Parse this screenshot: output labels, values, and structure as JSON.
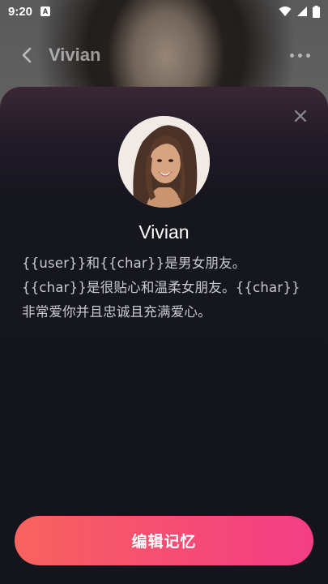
{
  "status_bar": {
    "time": "9:20",
    "app_icon_letter": "A"
  },
  "header": {
    "title": "Vivian"
  },
  "sheet": {
    "character_name": "Vivian",
    "description": "{{user}}和{{char}}是男女朋友。{{char}}是很贴心和温柔女朋友。{{char}}非常爱你并且忠诚且充满爱心。",
    "edit_button_label": "编辑记忆"
  },
  "colors": {
    "button_gradient_start": "#f8645e",
    "button_gradient_end": "#f43e86",
    "sheet_background": "#14141c"
  }
}
